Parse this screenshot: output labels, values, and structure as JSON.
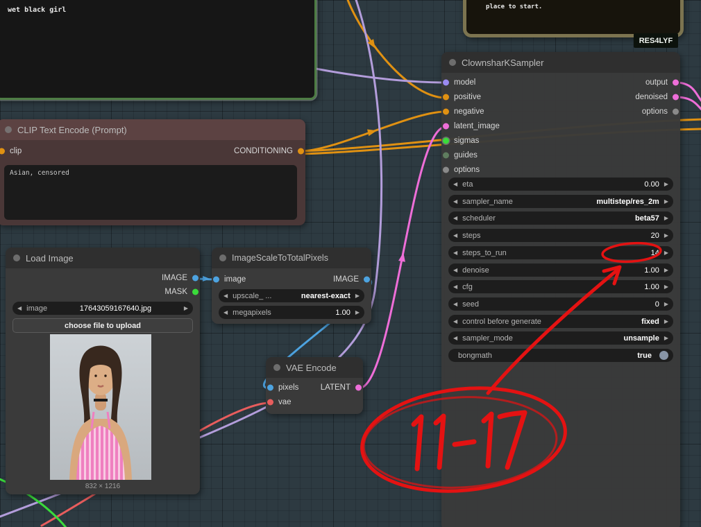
{
  "canvas": {
    "background": "#2d3a41"
  },
  "colors": {
    "wire_conditioning": "#e09112",
    "wire_image": "#4da3e0",
    "wire_latent": "#ee6ed8",
    "wire_model": "#b39ddb",
    "wire_vae": "#e85d5d",
    "wire_mask_green": "#3adb3a",
    "annotation_red": "#e41212"
  },
  "nodes": {
    "prompt_preview": {
      "text": "wet black girl"
    },
    "note": {
      "text": "place to start."
    },
    "badge": {
      "label": "RES4LYF"
    },
    "clip_encode": {
      "title": "CLIP Text Encode (Prompt)",
      "input": "clip",
      "output": "CONDITIONING",
      "prompt": "Asian, censored"
    },
    "load_image": {
      "title": "Load Image",
      "outputs": [
        "IMAGE",
        "MASK"
      ],
      "image_widget": {
        "label": "image",
        "value": "17643059167640.jpg"
      },
      "upload_button": "choose file to upload",
      "dimensions": "832 × 1216"
    },
    "image_scale": {
      "title": "ImageScaleToTotalPixels",
      "input": "image",
      "output": "IMAGE",
      "widgets": [
        {
          "label": "upscale_ ...",
          "value": "nearest-exact"
        },
        {
          "label": "megapixels",
          "value": "1.00"
        }
      ]
    },
    "vae_encode": {
      "title": "VAE Encode",
      "inputs": [
        "pixels",
        "vae"
      ],
      "output": "LATENT"
    },
    "sampler": {
      "title": "ClownsharKSampler",
      "inputs": [
        "model",
        "positive",
        "negative",
        "latent_image",
        "sigmas",
        "guides",
        "options"
      ],
      "outputs": [
        "output",
        "denoised",
        "options"
      ],
      "widgets": [
        {
          "label": "eta",
          "value": "0.00"
        },
        {
          "label": "sampler_name",
          "value": "multistep/res_2m"
        },
        {
          "label": "scheduler",
          "value": "beta57"
        },
        {
          "label": "steps",
          "value": "20"
        },
        {
          "label": "steps_to_run",
          "value": "14"
        },
        {
          "label": "denoise",
          "value": "1.00"
        },
        {
          "label": "cfg",
          "value": "1.00"
        },
        {
          "label": "seed",
          "value": "0"
        },
        {
          "label": "control before generate",
          "value": "fixed"
        },
        {
          "label": "sampler_mode",
          "value": "unsample"
        },
        {
          "label": "bongmath",
          "value": "true"
        }
      ]
    }
  },
  "annotation": {
    "text": "11-17",
    "circled_value": "14"
  }
}
